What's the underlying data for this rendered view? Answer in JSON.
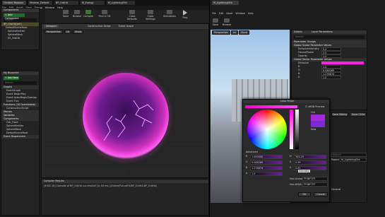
{
  "tabs": [
    "Content Browser",
    "Minimal_Default",
    "BP_OrbHA",
    "M_Energy",
    "M_LightningOrb"
  ],
  "preview_tab": "M_LightningOrb",
  "menu": [
    "File",
    "Edit",
    "Asset",
    "View",
    "Debug",
    "Window",
    "Help"
  ],
  "menu2": [
    "File",
    "Edit",
    "Asset",
    "Window",
    "Help"
  ],
  "toolbar": [
    "Save",
    "Browse",
    "Compile",
    "Find in CB",
    "Class Defaults",
    "Class Settings",
    "Class Defaults",
    "Simulation",
    "Play"
  ],
  "components": {
    "title": "Components",
    "add_button": "+ Add Component",
    "search": "Search",
    "items": [
      "BP_OrbHA(self)",
      "DefaultSceneRoot",
      "SphereEmitter",
      "SphereMesh",
      "ES_OrbHA"
    ]
  },
  "mybp": {
    "title": "My Blueprint",
    "add_button": "+ Add New",
    "search": "Search",
    "rows": [
      {
        "t": "Graphs",
        "s": true
      },
      {
        "t": "EventGraph"
      },
      {
        "t": "Event BeginPlay"
      },
      {
        "t": "Event ActorBeginOverlap"
      },
      {
        "t": "Event Tick"
      },
      {
        "t": "Functions (18 Overridable)",
        "s": true
      },
      {
        "t": "ConstructionScript"
      },
      {
        "t": "Macros",
        "s": true
      },
      {
        "t": "Variables",
        "s": true
      },
      {
        "t": "Components",
        "s": true
      },
      {
        "t": "Orb_Flash"
      },
      {
        "t": "SphereEmitter"
      },
      {
        "t": "SphereMesh"
      },
      {
        "t": "DefaultSceneRoot"
      },
      {
        "t": "Event Dispatchers",
        "s": true
      }
    ]
  },
  "viewport": {
    "title": "Viewport",
    "view": "Perspective",
    "lit": "Lit",
    "show": "Show",
    "tab2": "Construction Script",
    "tab3": "Event Graph"
  },
  "compiler": {
    "title": "Compiler Results",
    "text": "[4902.16] Compile of BP_OrbHA successful! [in 44 ms] (/Game/FutureFX/BP_OrbHA.BP_OrbHA)"
  },
  "preview": {
    "view": "Perspective",
    "lit": "Lit",
    "show": "Show"
  },
  "details": {
    "title": "Details",
    "tab2": "Layer Parameters",
    "search": "Search",
    "groups": [
      {
        "t": "Parameter Groups",
        "s": true
      },
      {
        "t": "Global Scalar Parameter Values",
        "s": true
      },
      {
        "t": "EmissiveIntensity",
        "v": "5.0"
      },
      {
        "t": "FresnelPower",
        "v": "2.0"
      },
      {
        "t": "Opacity",
        "v": "1.0"
      },
      {
        "t": "Global Vector Parameter Values",
        "s": true
      },
      {
        "t": "Emissive"
      },
      {
        "t": "R",
        "v": "1.0"
      },
      {
        "t": "G",
        "v": "0.048269"
      },
      {
        "t": "B",
        "v": "1.278674"
      },
      {
        "t": "A",
        "v": "1.0"
      }
    ]
  },
  "color_picker": {
    "title": "Color Picker",
    "srgb": "sRGB Preview",
    "old": "Old",
    "new": "New",
    "advanced": "Advanced",
    "rows": [
      {
        "l": "R",
        "v": "1.000000"
      },
      {
        "l": "G",
        "v": "0.048269"
      },
      {
        "l": "B",
        "v": "1.278674"
      },
      {
        "l": "A",
        "v": "1.0"
      }
    ],
    "hsv": [
      {
        "l": "H",
        "v": "304.29"
      },
      {
        "l": "S",
        "v": "0.99"
      },
      {
        "l": "V",
        "v": "0.61"
      }
    ],
    "hex_linear_label": "Hex Linear",
    "hex_linear": "FF0BF1FF",
    "hex_srgb_label": "Hex sRGB",
    "hex_srgb": "FF5BF7FF",
    "ok": "OK",
    "cancel": "Cancel",
    "tooltip": "Intensity"
  },
  "right": {
    "btn1": "Save Sibling",
    "btn2": "Save Child",
    "search": "Search",
    "label": "Parent",
    "drop": "M_LightningOrb",
    "label2": "General"
  }
}
